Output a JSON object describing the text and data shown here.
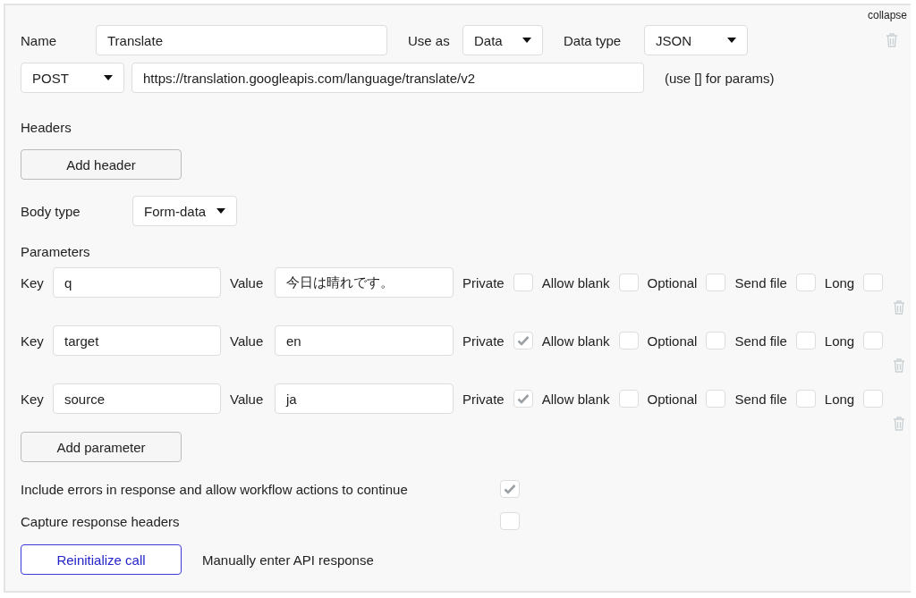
{
  "collapse_label": "collapse",
  "name": {
    "label": "Name",
    "value": "Translate"
  },
  "use_as": {
    "label": "Use as",
    "value": "Data"
  },
  "data_type": {
    "label": "Data type",
    "value": "JSON"
  },
  "method": "POST",
  "url": "https://translation.googleapis.com/language/translate/v2",
  "url_hint": "(use [] for params)",
  "headers_label": "Headers",
  "add_header_button": "Add header",
  "body_type": {
    "label": "Body type",
    "value": "Form-data"
  },
  "parameters_label": "Parameters",
  "parameters": [
    {
      "key_label": "Key",
      "key": "q",
      "value_label": "Value",
      "value": "今日は晴れです。",
      "options": [
        {
          "label": "Private",
          "checked": false
        },
        {
          "label": "Allow blank",
          "checked": false
        },
        {
          "label": "Optional",
          "checked": false
        },
        {
          "label": "Send file",
          "checked": false
        },
        {
          "label": "Long",
          "checked": false
        }
      ]
    },
    {
      "key_label": "Key",
      "key": "target",
      "value_label": "Value",
      "value": "en",
      "options": [
        {
          "label": "Private",
          "checked": true
        },
        {
          "label": "Allow blank",
          "checked": false
        },
        {
          "label": "Optional",
          "checked": false
        },
        {
          "label": "Send file",
          "checked": false
        },
        {
          "label": "Long",
          "checked": false
        }
      ]
    },
    {
      "key_label": "Key",
      "key": "source",
      "value_label": "Value",
      "value": "ja",
      "options": [
        {
          "label": "Private",
          "checked": true
        },
        {
          "label": "Allow blank",
          "checked": false
        },
        {
          "label": "Optional",
          "checked": false
        },
        {
          "label": "Send file",
          "checked": false
        },
        {
          "label": "Long",
          "checked": false
        }
      ]
    }
  ],
  "add_parameter_button": "Add parameter",
  "settings": [
    {
      "label": "Include errors in response and allow workflow actions to continue",
      "checked": true
    },
    {
      "label": "Capture response headers",
      "checked": false
    }
  ],
  "reinitialize_button": "Reinitialize call",
  "manual_link": "Manually enter API response"
}
